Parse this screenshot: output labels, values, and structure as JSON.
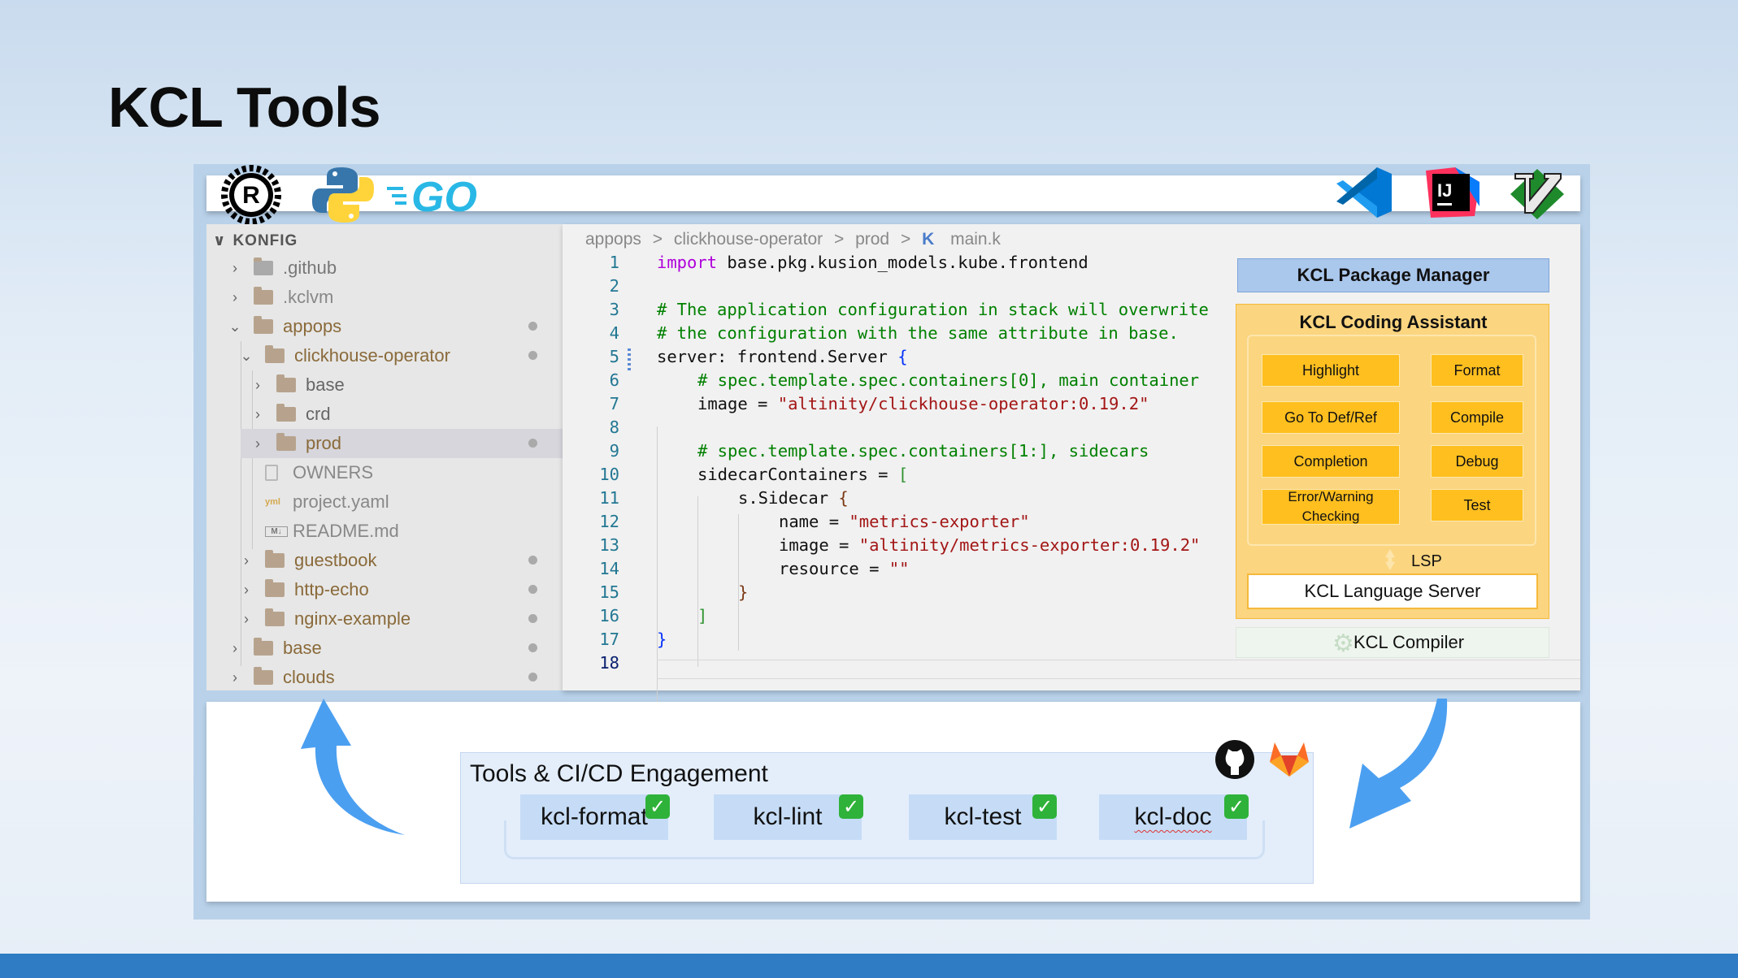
{
  "slide": {
    "title": "KCL Tools"
  },
  "toolbar": {
    "left_icons": [
      "rust-icon",
      "python-icon",
      "go-icon"
    ],
    "left_labels": {
      "rust": "R",
      "go": "GO"
    },
    "right_icons": [
      "vscode-icon",
      "intellij-icon",
      "vim-icon"
    ],
    "right_labels": {
      "intellij": "IJ"
    }
  },
  "explorer": {
    "header": "KONFIG",
    "items": [
      {
        "label": ".github",
        "kind": "folder",
        "modified": false
      },
      {
        "label": ".kclvm",
        "kind": "folder",
        "modified": false
      },
      {
        "label": "appops",
        "kind": "folder-open",
        "modified": true
      },
      {
        "label": "clickhouse-operator",
        "kind": "folder-open",
        "modified": true
      },
      {
        "label": "base",
        "kind": "folder",
        "modified": false
      },
      {
        "label": "crd",
        "kind": "folder",
        "modified": false
      },
      {
        "label": "prod",
        "kind": "folder",
        "modified": true,
        "selected": true
      },
      {
        "label": "OWNERS",
        "kind": "file",
        "modified": false
      },
      {
        "label": "project.yaml",
        "kind": "file",
        "modified": false
      },
      {
        "label": "README.md",
        "kind": "file",
        "modified": false
      },
      {
        "label": "guestbook",
        "kind": "folder",
        "modified": true
      },
      {
        "label": "http-echo",
        "kind": "folder",
        "modified": true
      },
      {
        "label": "nginx-example",
        "kind": "folder",
        "modified": true
      },
      {
        "label": "base",
        "kind": "folder",
        "modified": true
      },
      {
        "label": "clouds",
        "kind": "folder",
        "modified": true
      }
    ]
  },
  "editor": {
    "breadcrumb": [
      "appops",
      "clickhouse-operator",
      "prod",
      "main.k"
    ],
    "breadcrumb_sep": ">",
    "file_badge": "K",
    "line_numbers": [
      "1",
      "2",
      "3",
      "4",
      "5",
      "6",
      "7",
      "8",
      "9",
      "10",
      "11",
      "12",
      "13",
      "14",
      "15",
      "16",
      "17",
      "18"
    ],
    "lines": {
      "l1_kw": "import",
      "l1_rest": " base.pkg.kusion_models.kube.frontend",
      "l3": "# The application configuration in stack will overwrite",
      "l4": "# the configuration with the same attribute in base.",
      "l5_a": "server: frontend.Server ",
      "l5_b": "{",
      "l6": "# spec.template.spec.containers[0], main container",
      "l7_a": "image = ",
      "l7_b": "\"altinity/clickhouse-operator:0.19.2\"",
      "l9": "# spec.template.spec.containers[1:], sidecars",
      "l10_a": "sidecarContainers = ",
      "l10_b": "[",
      "l11_a": "s.Sidecar ",
      "l11_b": "{",
      "l12_a": "name = ",
      "l12_b": "\"metrics-exporter\"",
      "l13_a": "image = ",
      "l13_b": "\"altinity/metrics-exporter:0.19.2\"",
      "l14_a": "resource = ",
      "l14_b": "\"\"",
      "l15": "}",
      "l16": "]",
      "l17": "}"
    }
  },
  "architecture": {
    "package_manager": "KCL Package Manager",
    "coding_assistant": "KCL Coding Assistant",
    "features_left": [
      "Highlight",
      "Go To Def/Ref",
      "Completion",
      "Error/Warning Checking"
    ],
    "features_right": [
      "Format",
      "Compile",
      "Debug",
      "Test"
    ],
    "lsp": "LSP",
    "language_server": "KCL Language Server",
    "compiler": "KCL Compiler"
  },
  "cicd": {
    "title": "Tools & CI/CD Engagement",
    "tools": [
      "kcl-format",
      "kcl-lint",
      "kcl-test",
      "kcl-doc"
    ],
    "check_mark": "✓",
    "platform_icons": [
      "github-icon",
      "gitlab-icon"
    ]
  },
  "colors": {
    "brand_blue": "#2f7cc4",
    "arrow_blue": "#4b9ff0",
    "assistant_yellow": "#fbd580",
    "feature_yellow": "#ffbf1f",
    "check_green": "#2fb239"
  }
}
